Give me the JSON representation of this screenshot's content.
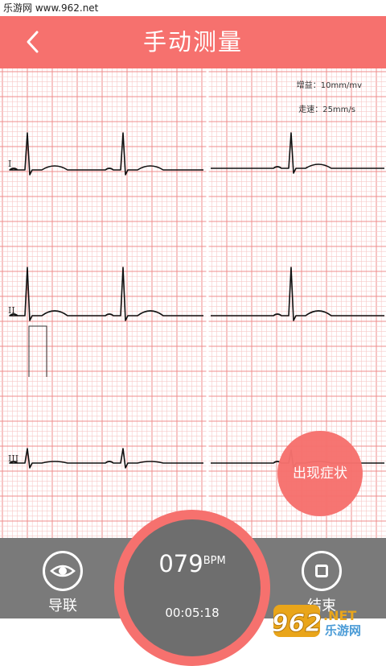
{
  "watermark_top": "乐游网 www.962.net",
  "header": {
    "title": "手动测量"
  },
  "ecg": {
    "gain": "增益：10mm/mv",
    "speed": "走速：25mm/s",
    "leads": [
      "I",
      "II",
      "III"
    ]
  },
  "symptom_button": "出现症状",
  "controls": {
    "lead_label": "导联",
    "end_label": "结束"
  },
  "monitor": {
    "bpm_value": "079",
    "bpm_unit": "BPM",
    "elapsed": "00:05:18"
  },
  "logo": {
    "text": "962",
    "sub": "乐游网",
    "suffix": ".NET"
  },
  "colors": {
    "accent": "#f6716e",
    "grid_minor": "#f8c9c8",
    "grid_major": "#ef8e8c",
    "bar": "#7a7a7a"
  }
}
